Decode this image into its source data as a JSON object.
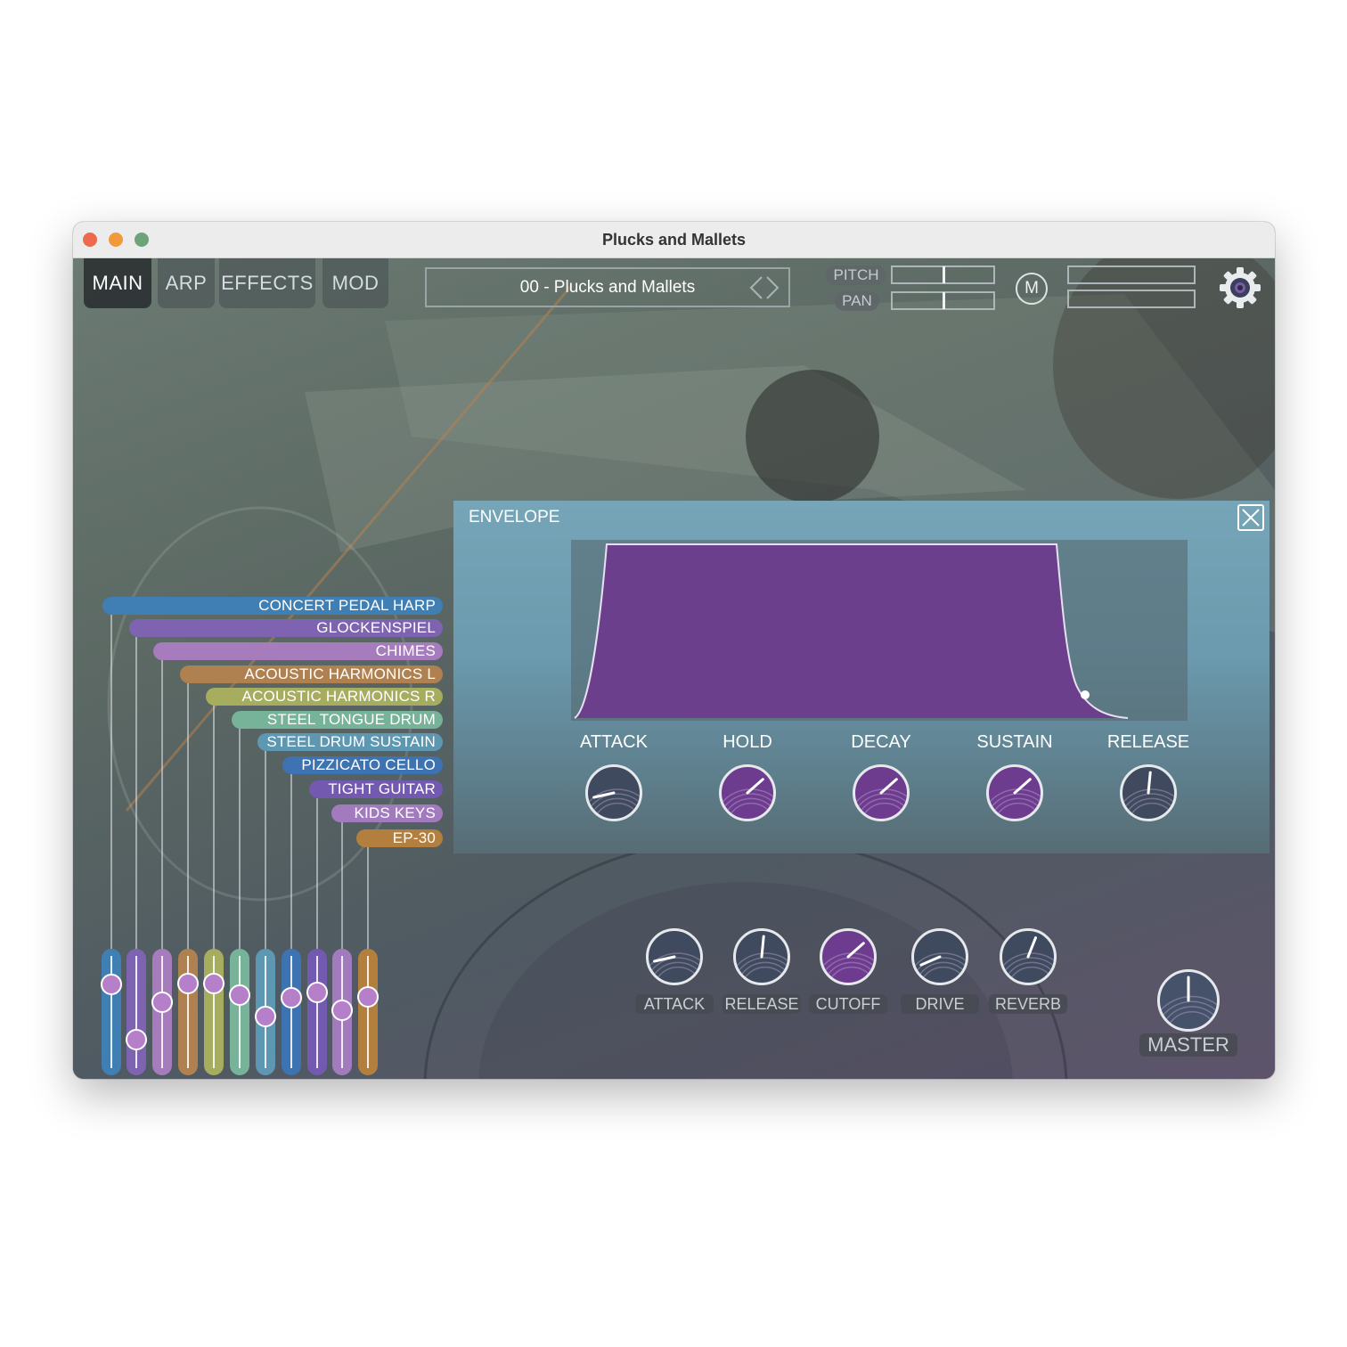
{
  "window": {
    "title": "Plucks and Mallets",
    "traffic_lights": [
      "#ee6a4f",
      "#f09a3c",
      "#6ea37a"
    ]
  },
  "tabs": [
    {
      "label": "MAIN",
      "active": true
    },
    {
      "label": "ARP",
      "active": false
    },
    {
      "label": "EFFECTS",
      "active": false
    },
    {
      "label": "MOD",
      "active": false
    }
  ],
  "preset": {
    "name": "00 - Plucks and Mallets",
    "nav_icon": "chevron-left-right-icon"
  },
  "meters": {
    "pitch_label": "PITCH",
    "pan_label": "PAN"
  },
  "mono_button": {
    "label": "M"
  },
  "settings": {
    "icon": "gear-icon"
  },
  "layers": [
    {
      "name": "CONCERT PEDAL HARP",
      "color": "#3f7fb3",
      "level": 0.76
    },
    {
      "name": "GLOCKENSPIEL",
      "color": "#7d63b0",
      "level": 0.27
    },
    {
      "name": "CHIMES",
      "color": "#a77cbd",
      "level": 0.6
    },
    {
      "name": "ACOUSTIC HARMONICS L",
      "color": "#b08150",
      "level": 0.77
    },
    {
      "name": "ACOUSTIC HARMONICS R",
      "color": "#a7ad5f",
      "level": 0.77
    },
    {
      "name": "STEEL TONGUE DRUM",
      "color": "#76b398",
      "level": 0.67
    },
    {
      "name": "STEEL DRUM SUSTAIN",
      "color": "#5d97b2",
      "level": 0.48
    },
    {
      "name": "PIZZICATO CELLO",
      "color": "#3d73b0",
      "level": 0.64
    },
    {
      "name": "TIGHT GUITAR",
      "color": "#7359b0",
      "level": 0.69
    },
    {
      "name": "KIDS KEYS",
      "color": "#a17bbd",
      "level": 0.53
    },
    {
      "name": "EP-30",
      "color": "#b27f3f",
      "level": 0.65
    }
  ],
  "envelope": {
    "title": "ENVELOPE",
    "close_icon": "close-icon",
    "fill_color": "#6c3f8c",
    "knobs": [
      {
        "label": "ATTACK",
        "value": 0.12,
        "style": "dark"
      },
      {
        "label": "HOLD",
        "value": 0.68,
        "style": "purple"
      },
      {
        "label": "DECAY",
        "value": 0.68,
        "style": "purple"
      },
      {
        "label": "SUSTAIN",
        "value": 0.68,
        "style": "purple"
      },
      {
        "label": "RELEASE",
        "value": 0.52,
        "style": "dark"
      }
    ]
  },
  "macros": [
    {
      "label": "ATTACK",
      "value": 0.12,
      "style": "dark"
    },
    {
      "label": "RELEASE",
      "value": 0.52,
      "style": "dark"
    },
    {
      "label": "CUTOFF",
      "value": 0.68,
      "style": "purple"
    },
    {
      "label": "DRIVE",
      "value": 0.08,
      "style": "dark"
    },
    {
      "label": "REVERB",
      "value": 0.58,
      "style": "dark"
    }
  ],
  "master": {
    "label": "MASTER",
    "value": 0.5
  }
}
